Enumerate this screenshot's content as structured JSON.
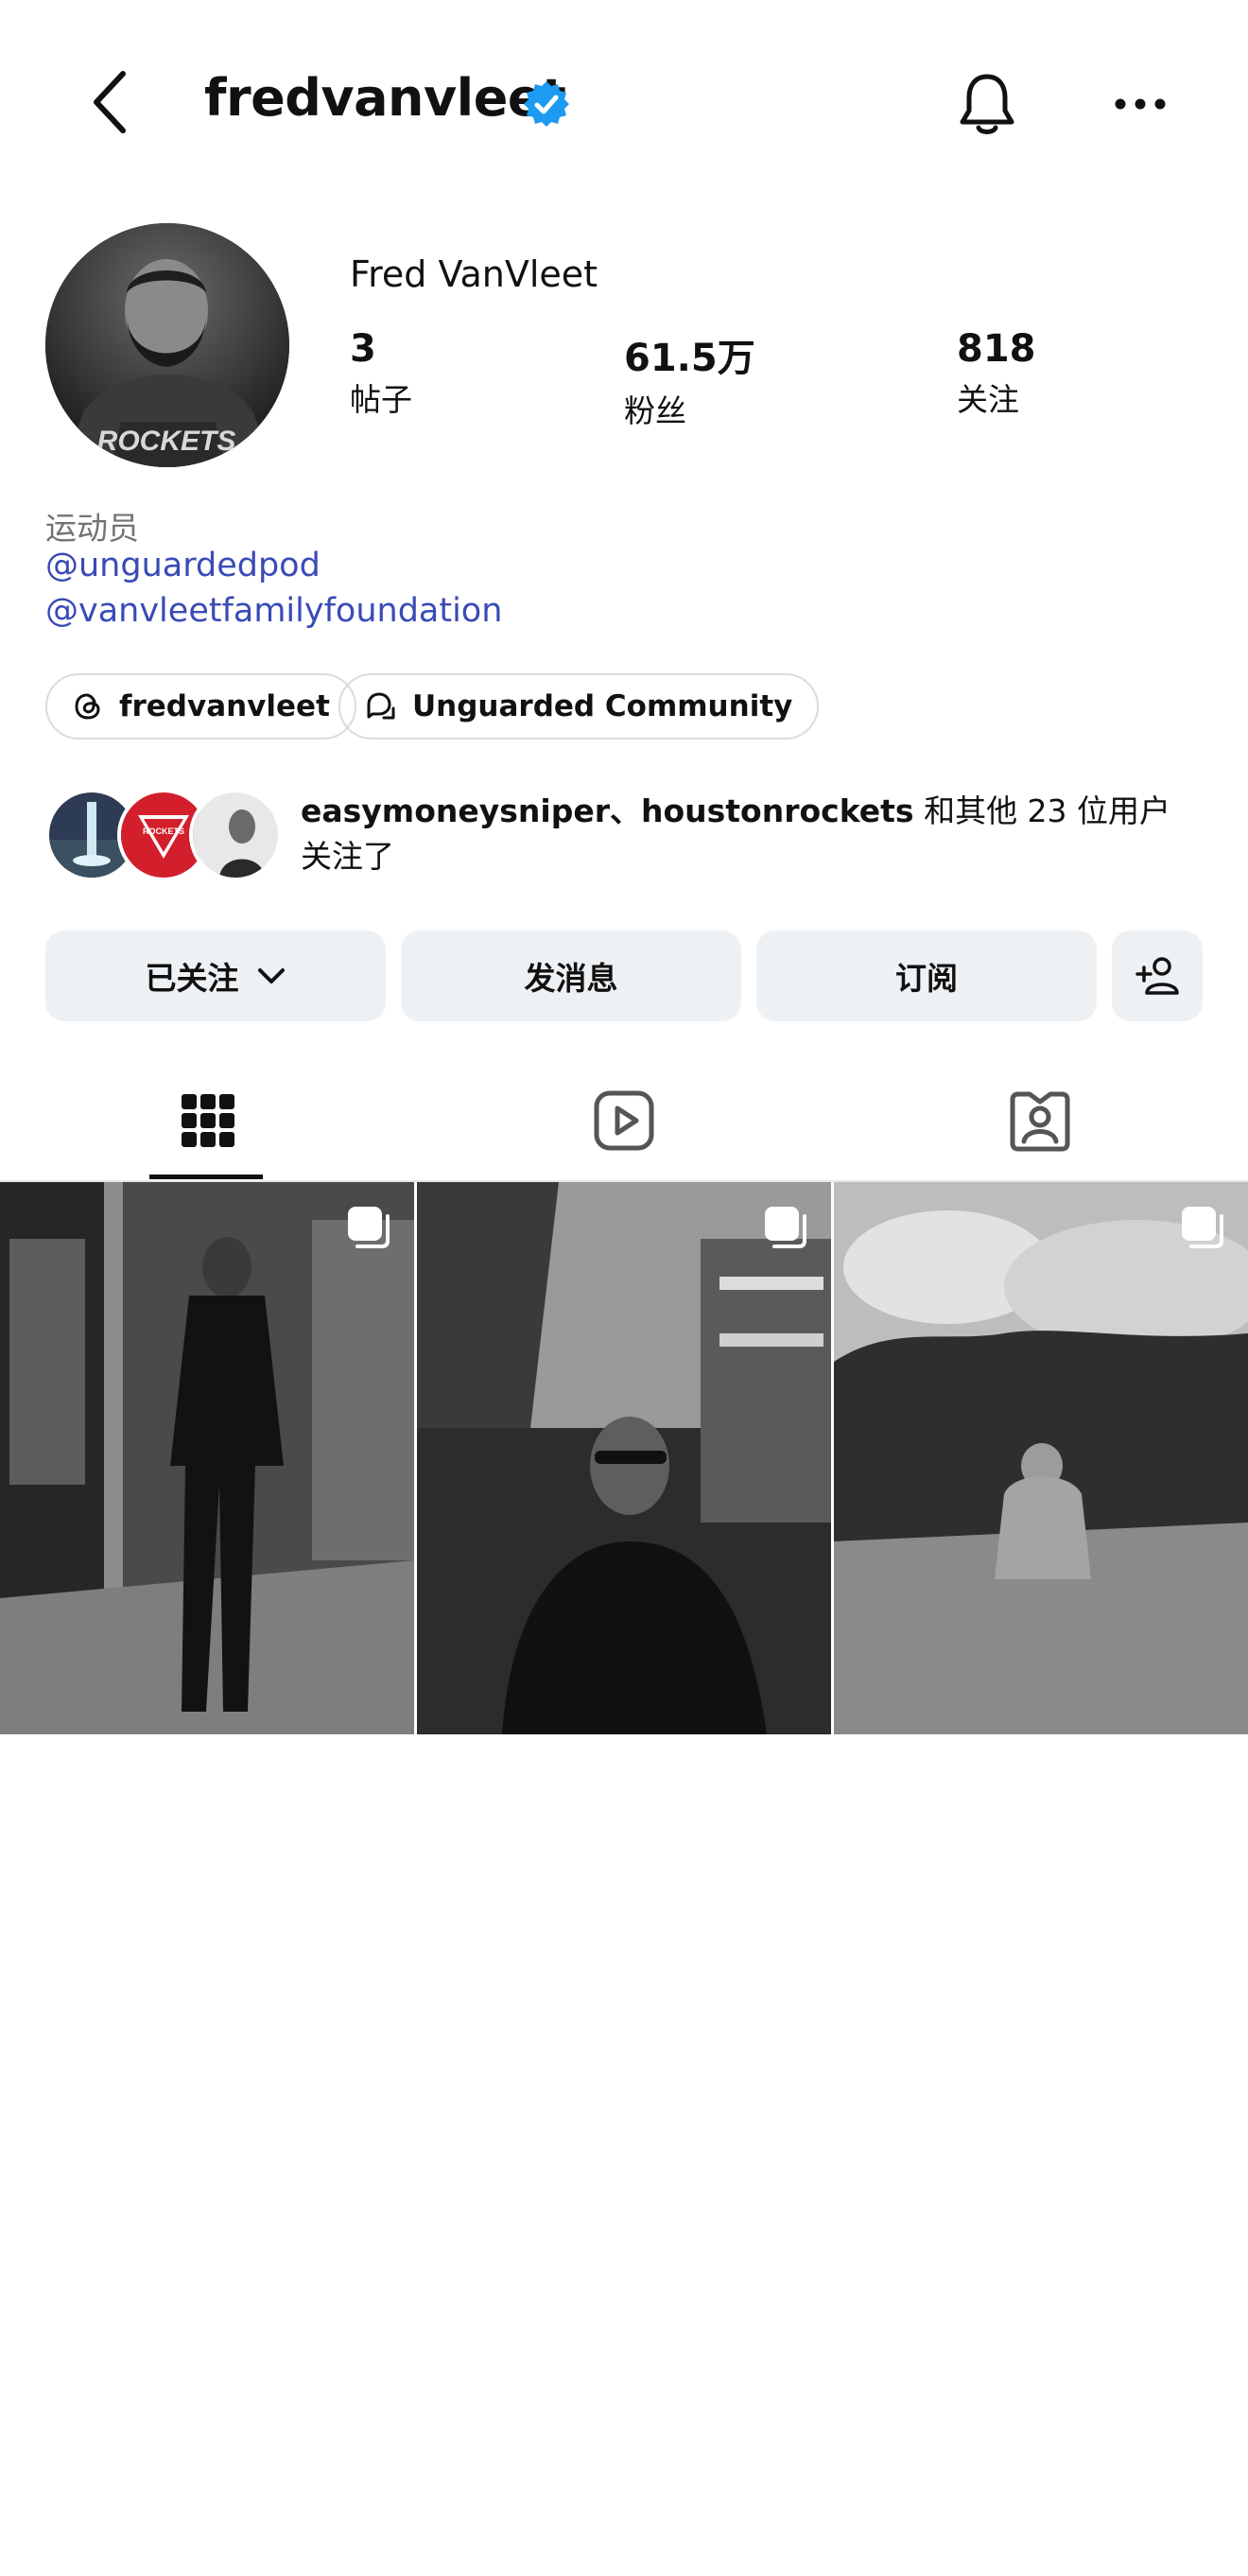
{
  "header": {
    "username": "fredvanvleet",
    "verified": true,
    "back_icon": "chevron-left-icon",
    "bell_icon": "bell-icon",
    "more_icon": "more-horizontal-icon"
  },
  "profile": {
    "full_name": "Fred VanVleet",
    "stats": [
      {
        "value": "3",
        "label": "帖子"
      },
      {
        "value": "61.5万",
        "label": "粉丝"
      },
      {
        "value": "818",
        "label": "关注"
      }
    ],
    "category": "运动员",
    "links": [
      "@unguardedpod",
      "@vanvleetfamilyfoundation"
    ],
    "pills": [
      {
        "icon": "threads-icon",
        "label": "fredvanvleet"
      },
      {
        "icon": "community-icon",
        "label": "Unguarded Community"
      }
    ],
    "followed_by": {
      "names": "easymoneysniper、houstonrockets",
      "rest": " 和其他 23 位用户关注了"
    }
  },
  "actions": {
    "following": "已关注",
    "message": "发消息",
    "subscribe": "订阅",
    "add_user_icon": "add-user-icon"
  },
  "tabs": [
    "grid-icon",
    "reels-icon",
    "tagged-icon"
  ],
  "colors": {
    "link": "#3a4ab6",
    "verified": "#1d9bf0",
    "button_bg": "#eef1f4",
    "muted": "#737373"
  }
}
